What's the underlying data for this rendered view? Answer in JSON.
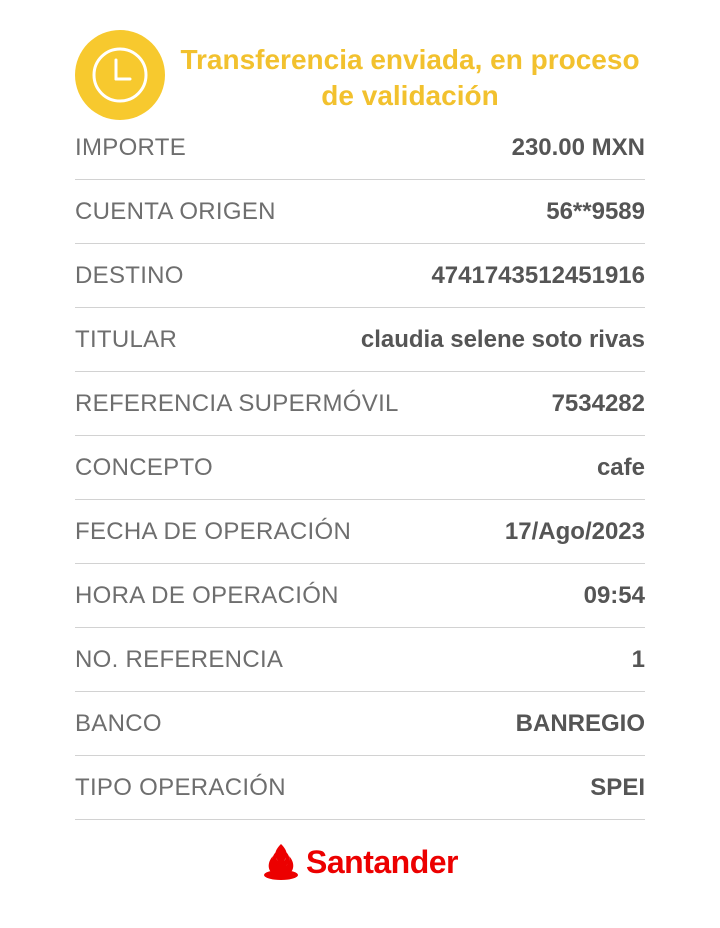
{
  "header": {
    "title": "Transferencia enviada, en proceso de validación",
    "status_icon": "clock-icon",
    "accent_color": "#f7c92e"
  },
  "details": [
    {
      "label": "IMPORTE",
      "value": "230.00 MXN"
    },
    {
      "label": "CUENTA ORIGEN",
      "value": "56**9589"
    },
    {
      "label": "DESTINO",
      "value": "4741743512451916"
    },
    {
      "label": "TITULAR",
      "value": "claudia selene soto rivas"
    },
    {
      "label": "REFERENCIA SUPERMÓVIL",
      "value": "7534282"
    },
    {
      "label": "CONCEPTO",
      "value": "cafe"
    },
    {
      "label": "FECHA DE OPERACIÓN",
      "value": "17/Ago/2023"
    },
    {
      "label": "HORA DE OPERACIÓN",
      "value": "09:54"
    },
    {
      "label": "NO. REFERENCIA",
      "value": "1"
    },
    {
      "label": "BANCO",
      "value": "BANREGIO"
    },
    {
      "label": "TIPO OPERACIÓN",
      "value": "SPEI"
    }
  ],
  "footer": {
    "brand": "Santander",
    "brand_icon": "flame-icon",
    "brand_color": "#ec0000"
  }
}
